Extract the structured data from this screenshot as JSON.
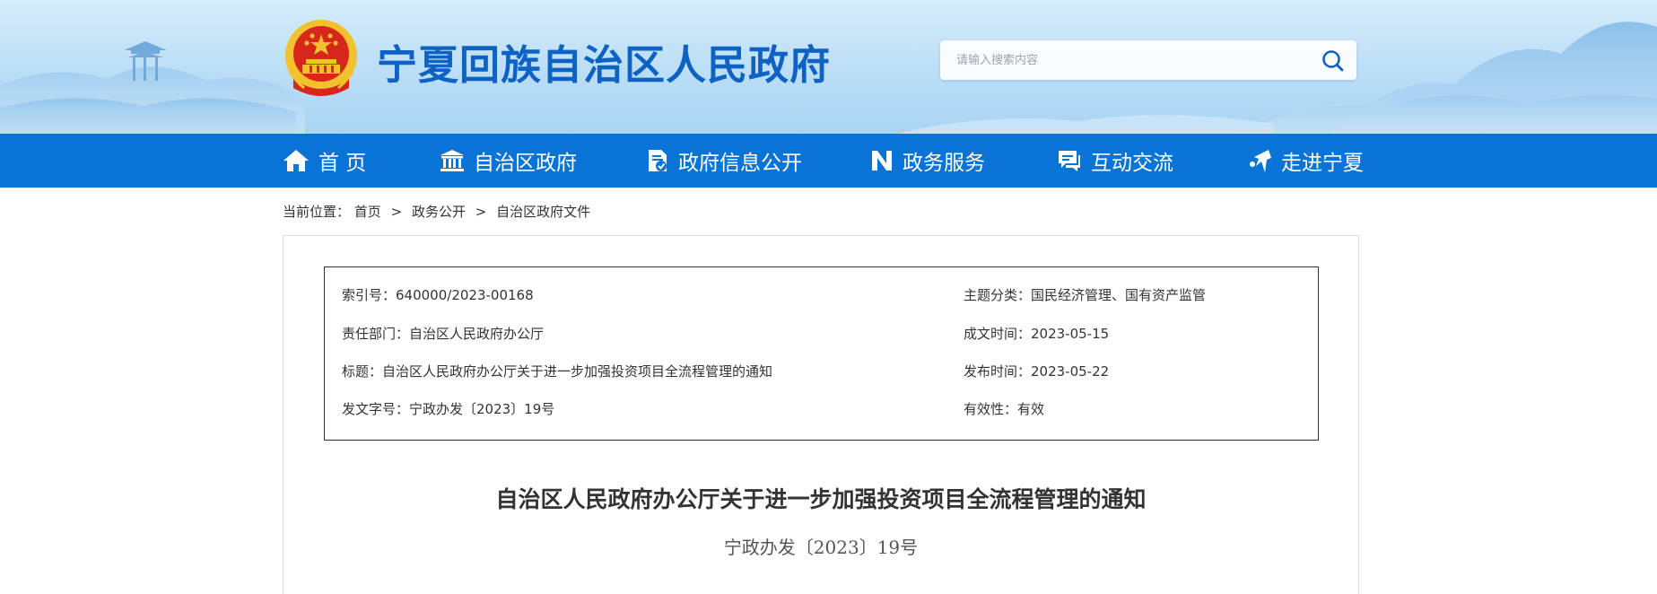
{
  "header": {
    "site_title": "宁夏回族自治区人民政府",
    "search_placeholder": "请输入搜索内容"
  },
  "nav": {
    "items": [
      {
        "label": "首 页",
        "icon": "home-icon"
      },
      {
        "label": "自治区政府",
        "icon": "government-building-icon"
      },
      {
        "label": "政府信息公开",
        "icon": "document-check-icon"
      },
      {
        "label": "政务服务",
        "icon": "service-n-icon"
      },
      {
        "label": "互动交流",
        "icon": "chat-bubble-icon"
      },
      {
        "label": "走进宁夏",
        "icon": "travel-icon"
      }
    ]
  },
  "breadcrumb": {
    "prefix": "当前位置：",
    "items": [
      "首页",
      "政务公开",
      "自治区政府文件"
    ],
    "separator": ">"
  },
  "meta": {
    "index_no": "索引号：640000/2023-00168",
    "topic": "主题分类：国民经济管理、国有资产监管",
    "department": "责任部门：自治区人民政府办公厅",
    "created_date": "成文时间：2023-05-15",
    "title": "标题：自治区人民政府办公厅关于进一步加强投资项目全流程管理的通知",
    "published_date": "发布时间：2023-05-22",
    "doc_no": "发文字号：宁政办发〔2023〕19号",
    "validity": "有效性：有效"
  },
  "document": {
    "title": "自治区人民政府办公厅关于进一步加强投资项目全流程管理的通知",
    "number": "宁政办发〔2023〕19号"
  },
  "colors": {
    "brand_blue": "#0e62c3",
    "nav_blue": "#0a73d6",
    "emblem_red": "#d7261c",
    "emblem_gold": "#f2c12e"
  }
}
